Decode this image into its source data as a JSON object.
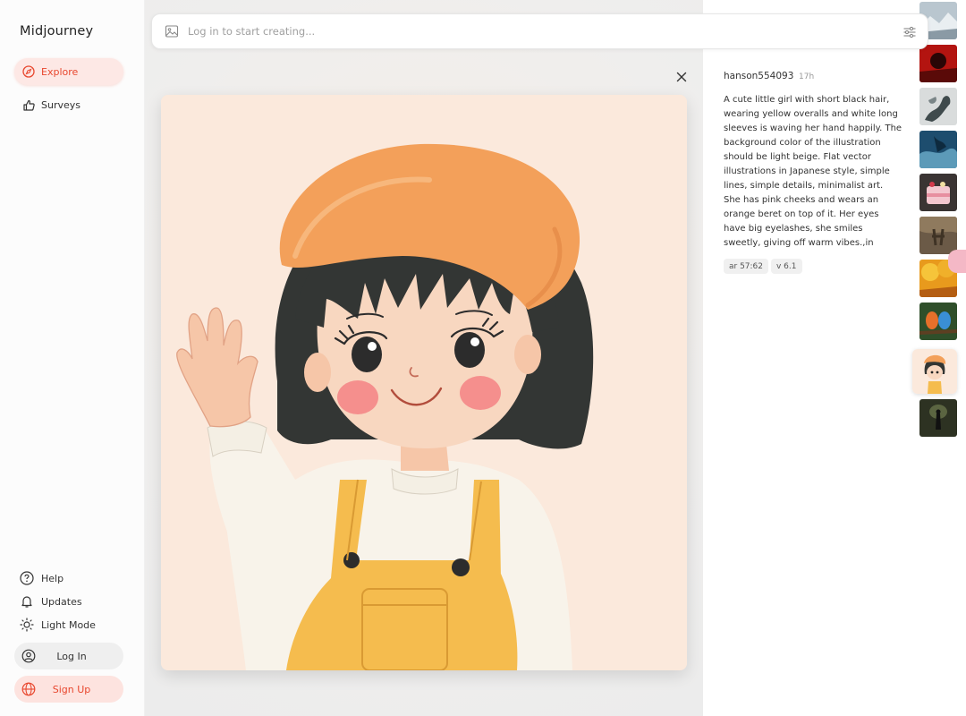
{
  "app": {
    "name": "Midjourney"
  },
  "sidebar": {
    "items": [
      {
        "label": "Explore",
        "icon": "compass-icon",
        "active": true
      },
      {
        "label": "Surveys",
        "icon": "thumbs-up-icon",
        "active": false
      }
    ],
    "bottom": [
      {
        "label": "Help",
        "icon": "help-icon"
      },
      {
        "label": "Updates",
        "icon": "bell-icon"
      },
      {
        "label": "Light Mode",
        "icon": "sun-icon"
      }
    ],
    "login_label": "Log In",
    "signup_label": "Sign Up"
  },
  "search": {
    "placeholder": "Log in to start creating..."
  },
  "detail": {
    "author": "hanson554093",
    "time": "17h",
    "prompt": "A cute little girl with short black hair, wearing yellow overalls and white long sleeves is waving her hand happily. The background color of the illustration should be light beige. Flat vector illustrations in Japanese style, simple lines, simple details, minimalist art. She has pink cheeks and wears an orange beret on top of it. Her eyes have big eyelashes, she smiles sweetly, giving off warm vibes.,in",
    "tags": [
      "ar 57:62",
      "v 6.1"
    ]
  },
  "colors": {
    "accent": "#e8472e",
    "accent_bg": "#fde8e5",
    "beret": "#f3a05a",
    "overalls": "#f5bc4e",
    "hair": "#333634",
    "art_bg": "#fbe9dc"
  }
}
